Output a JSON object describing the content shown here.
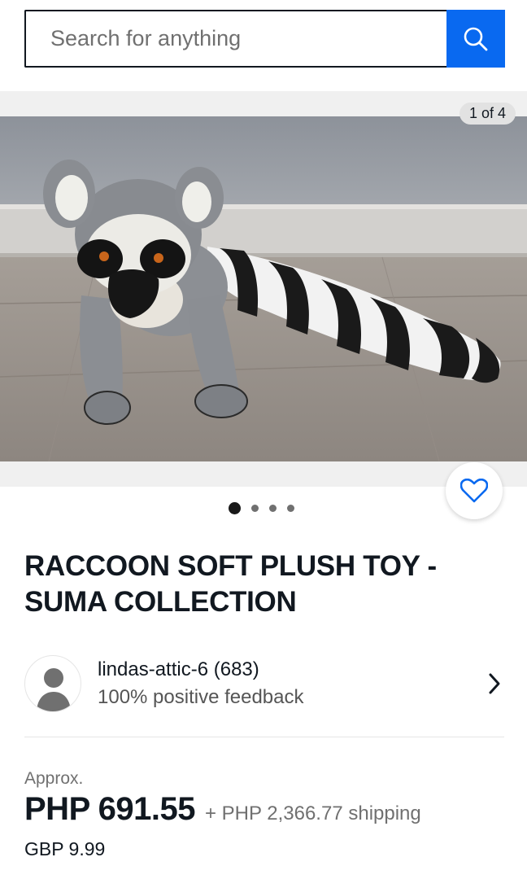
{
  "search": {
    "placeholder": "Search for anything",
    "value": "",
    "button_icon": "search-icon"
  },
  "gallery": {
    "counter": "1 of 4",
    "total_images": 4,
    "active_index": 0,
    "image_subject": "ring-tailed lemur plush toy on wooden floor",
    "favorite_icon": "heart-outline-icon"
  },
  "listing": {
    "title": "RACCOON SOFT PLUSH TOY - SUMA COLLECTION"
  },
  "seller": {
    "name": "lindas-attic-6 (683)",
    "feedback": "100% positive feedback",
    "avatar_icon": "user-avatar-icon",
    "chevron_icon": "chevron-right-icon"
  },
  "price": {
    "approx_label": "Approx.",
    "main": "PHP 691.55",
    "shipping": "+ PHP 2,366.77 shipping",
    "original": "GBP 9.99"
  },
  "colors": {
    "accent": "#0969f0",
    "text": "#111820",
    "secondary_text": "#707070",
    "heart": "#0969f0"
  }
}
